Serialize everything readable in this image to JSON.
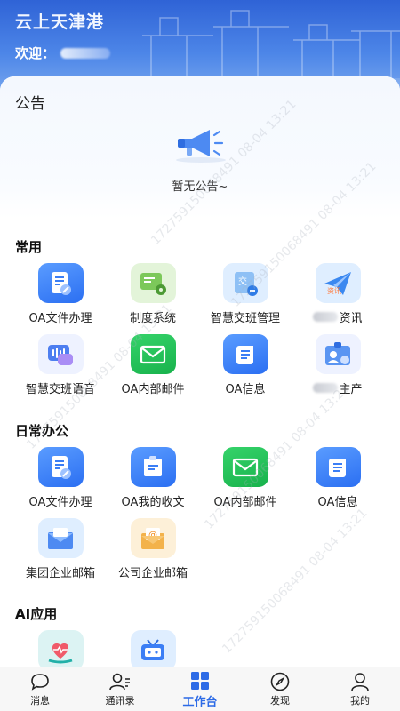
{
  "header": {
    "title": "云上天津港",
    "welcome_label": "欢迎："
  },
  "notice": {
    "title": "公告",
    "empty_text": "暂无公告~"
  },
  "sections": [
    {
      "title": "常用",
      "items": [
        {
          "label": "OA文件办理",
          "icon": "document-edit-icon"
        },
        {
          "label": "制度系统",
          "icon": "rules-system-icon"
        },
        {
          "label": "智慧交班管理",
          "icon": "shift-handover-icon"
        },
        {
          "label": "资讯",
          "icon": "news-plane-icon",
          "label_prefix_blurred": true
        },
        {
          "label": "智慧交班语音",
          "icon": "voice-message-icon"
        },
        {
          "label": "OA内部邮件",
          "icon": "mail-icon"
        },
        {
          "label": "OA信息",
          "icon": "scroll-icon"
        },
        {
          "label": "主产",
          "icon": "id-card-icon",
          "label_prefix_blurred": true
        }
      ]
    },
    {
      "title": "日常办公",
      "items": [
        {
          "label": "OA文件办理",
          "icon": "document-edit-icon"
        },
        {
          "label": "OA我的收文",
          "icon": "inbox-document-icon"
        },
        {
          "label": "OA内部邮件",
          "icon": "mail-icon"
        },
        {
          "label": "OA信息",
          "icon": "scroll-icon"
        },
        {
          "label": "集团企业邮箱",
          "icon": "group-mailbox-icon"
        },
        {
          "label": "公司企业邮箱",
          "icon": "company-mailbox-icon"
        }
      ]
    },
    {
      "title": "AI应用",
      "items": [
        {
          "label": "",
          "icon": "health-care-icon"
        },
        {
          "label": "",
          "icon": "tv-robot-icon"
        }
      ]
    }
  ],
  "watermark": "17275915006849​1 08-04 13:21",
  "tabbar": [
    {
      "label": "消息",
      "icon": "message-bubble-icon",
      "active": false
    },
    {
      "label": "通讯录",
      "icon": "contacts-icon",
      "active": false
    },
    {
      "label": "工作台",
      "icon": "grid-workbench-icon",
      "active": true
    },
    {
      "label": "发现",
      "icon": "compass-icon",
      "active": false
    },
    {
      "label": "我的",
      "icon": "person-icon",
      "active": false
    }
  ],
  "colors": {
    "primary": "#2d6be6",
    "header_top": "#2f63d6",
    "green": "#1fbf55"
  }
}
